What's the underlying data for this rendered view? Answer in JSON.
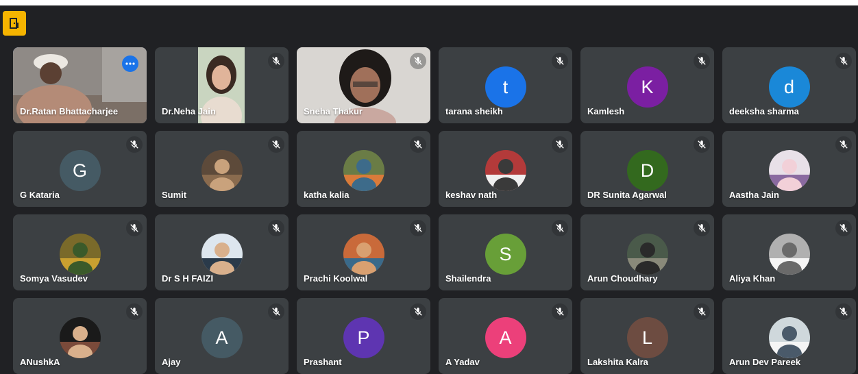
{
  "app": {
    "icon": "door-exit-icon",
    "accent": "#f6b400"
  },
  "participants": [
    {
      "name": "Dr.Ratan Bhattacharjee",
      "kind": "video",
      "active": true
    },
    {
      "name": "Dr.Neha Jain",
      "kind": "video"
    },
    {
      "name": "Sneha Thakur",
      "kind": "video"
    },
    {
      "name": "tarana sheikh",
      "kind": "letter",
      "initial": "t",
      "color": "#1a73e8"
    },
    {
      "name": "Kamlesh",
      "kind": "letter",
      "initial": "K",
      "color": "#7b1fa2"
    },
    {
      "name": "deeksha sharma",
      "kind": "letter",
      "initial": "d",
      "color": "#1a88d8"
    },
    {
      "name": "G Kataria",
      "kind": "letter",
      "initial": "G",
      "color": "#455a64"
    },
    {
      "name": "Sumit",
      "kind": "photo"
    },
    {
      "name": "katha kalia",
      "kind": "photo"
    },
    {
      "name": "keshav nath",
      "kind": "photo"
    },
    {
      "name": "DR Sunita Agarwal",
      "kind": "letter",
      "initial": "D",
      "color": "#33691e"
    },
    {
      "name": "Aastha Jain",
      "kind": "photo"
    },
    {
      "name": "Somya Vasudev",
      "kind": "photo"
    },
    {
      "name": "Dr S H FAIZI",
      "kind": "photo"
    },
    {
      "name": "Prachi Koolwal",
      "kind": "photo"
    },
    {
      "name": "Shailendra",
      "kind": "letter",
      "initial": "S",
      "color": "#689f38"
    },
    {
      "name": "Arun Choudhary",
      "kind": "photo"
    },
    {
      "name": "Aliya Khan",
      "kind": "photo"
    },
    {
      "name": "ANushkA",
      "kind": "photo"
    },
    {
      "name": "Ajay",
      "kind": "letter",
      "initial": "A",
      "color": "#455a64"
    },
    {
      "name": "Prashant",
      "kind": "letter",
      "initial": "P",
      "color": "#5e35b1"
    },
    {
      "name": "A Yadav",
      "kind": "letter",
      "initial": "A",
      "color": "#ec407a"
    },
    {
      "name": "Lakshita Kalra",
      "kind": "letter",
      "initial": "L",
      "color": "#6d4c41"
    },
    {
      "name": "Arun Dev Pareek",
      "kind": "photo"
    }
  ]
}
